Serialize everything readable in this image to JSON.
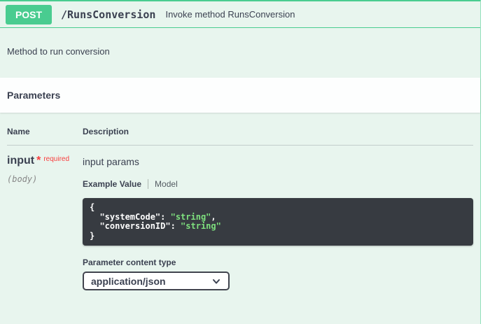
{
  "colors": {
    "method_badge_green": "#49cc90",
    "block_background_green": "#e8f5ee",
    "border_green": "#49cc90",
    "heading_text": "#3b4151",
    "required_red": "#f93e3e",
    "muted_gray": "#888888",
    "code_background": "#373b41",
    "code_text_white": "#ffffff",
    "code_string_green": "#7ee07e"
  },
  "operation": {
    "method": "POST",
    "path": "/RunsConversion",
    "summary": "Invoke method RunsConversion",
    "description": "Method to run conversion"
  },
  "parameters": {
    "section_title": "Parameters",
    "columns": {
      "name": "Name",
      "description": "Description"
    },
    "param": {
      "name": "input",
      "required_star": "*",
      "required_label": "required",
      "location": "(body)",
      "description": "input params",
      "tabs": {
        "example": "Example Value",
        "model": "Model"
      },
      "example": {
        "brace_open": "{",
        "lines": [
          {
            "key": "  \"systemCode\": ",
            "value": "\"string\"",
            "suffix": ","
          },
          {
            "key": "  \"conversionID\": ",
            "value": "\"string\"",
            "suffix": ""
          }
        ],
        "brace_close": "}"
      },
      "content_type_label": "Parameter content type",
      "content_type_value": "application/json"
    }
  }
}
